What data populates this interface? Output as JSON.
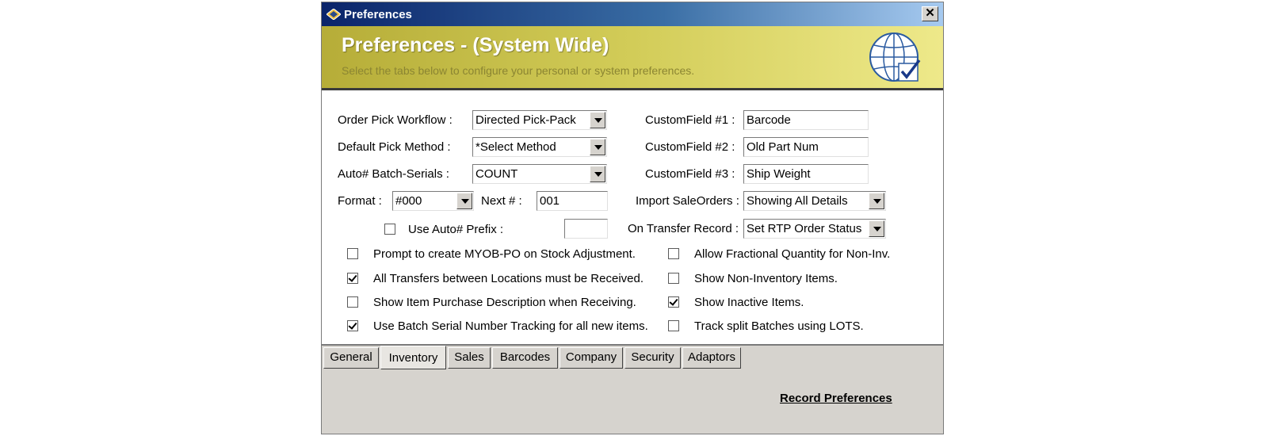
{
  "window": {
    "title": "Preferences",
    "close_glyph": "✕"
  },
  "banner": {
    "title": "Preferences - (System Wide)",
    "subtitle": "Select the tabs below to configure your personal or system preferences."
  },
  "form": {
    "order_pick_workflow": {
      "label": "Order Pick Workflow :",
      "value": "Directed Pick-Pack"
    },
    "default_pick_method": {
      "label": "Default Pick Method :",
      "value": "*Select Method"
    },
    "auto_batch_serials": {
      "label": "Auto# Batch-Serials :",
      "value": "COUNT"
    },
    "format": {
      "label": "Format :",
      "value": "#000"
    },
    "next": {
      "label": "Next # :",
      "value": "001"
    },
    "use_auto_prefix": {
      "label": "Use Auto# Prefix :",
      "checked": false,
      "value": ""
    },
    "custom_field_1": {
      "label": "CustomField #1 :",
      "value": "Barcode"
    },
    "custom_field_2": {
      "label": "CustomField #2 :",
      "value": "Old Part Num"
    },
    "custom_field_3": {
      "label": "CustomField #3 :",
      "value": "Ship Weight"
    },
    "import_sale_orders": {
      "label": "Import SaleOrders :",
      "value": "Showing All Details"
    },
    "on_transfer_record": {
      "label": "On Transfer Record :",
      "value": "Set RTP Order Status"
    }
  },
  "checkboxes_left": [
    {
      "label": "Prompt to create MYOB-PO on Stock Adjustment.",
      "checked": false
    },
    {
      "label": "All Transfers between Locations must be Received.",
      "checked": true
    },
    {
      "label": "Show Item Purchase Description when Receiving.",
      "checked": false
    },
    {
      "label": "Use Batch Serial Number Tracking for all new items.",
      "checked": true
    }
  ],
  "checkboxes_right": [
    {
      "label": "Allow Fractional Quantity for Non-Inv.",
      "checked": false
    },
    {
      "label": "Show Non-Inventory Items.",
      "checked": false
    },
    {
      "label": "Show Inactive Items.",
      "checked": true
    },
    {
      "label": "Track split Batches using LOTS.",
      "checked": false
    }
  ],
  "tabs": [
    {
      "label": "General",
      "active": false
    },
    {
      "label": "Inventory",
      "active": true
    },
    {
      "label": "Sales",
      "active": false
    },
    {
      "label": "Barcodes",
      "active": false
    },
    {
      "label": "Company",
      "active": false
    },
    {
      "label": "Security",
      "active": false
    },
    {
      "label": "Adaptors",
      "active": false
    }
  ],
  "footer": {
    "record_label": "Record Preferences"
  },
  "icons": {
    "app": "diamond-app-icon",
    "globe": "globe-check-icon"
  },
  "colors": {
    "title_bar": "#0a246a",
    "banner": "#d2cc58",
    "window_bg": "#d6d3ce"
  }
}
